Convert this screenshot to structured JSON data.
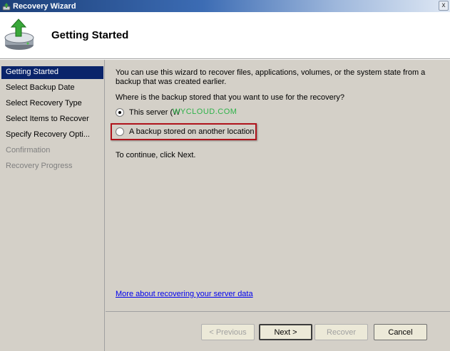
{
  "window": {
    "title": "Recovery Wizard",
    "close_glyph": "x"
  },
  "header": {
    "title": "Getting Started"
  },
  "nav": {
    "items": [
      {
        "label": "Getting Started",
        "state": "active"
      },
      {
        "label": "Select Backup Date",
        "state": "enabled"
      },
      {
        "label": "Select Recovery Type",
        "state": "enabled"
      },
      {
        "label": "Select Items to Recover",
        "state": "enabled"
      },
      {
        "label": "Specify Recovery Opti...",
        "state": "enabled"
      },
      {
        "label": "Confirmation",
        "state": "disabled"
      },
      {
        "label": "Recovery Progress",
        "state": "disabled"
      }
    ]
  },
  "content": {
    "intro": "You can use this wizard to recover files, applications, volumes, or the system state from a backup that was created earlier.",
    "question": "Where is the backup stored that you want to use for the recovery?",
    "options": [
      {
        "label": "This server (W",
        "checked": true
      },
      {
        "label": "A backup stored on another location",
        "checked": false
      }
    ],
    "watermark": "WYCLOUD.COM",
    "continue_text": "To continue, click Next.",
    "help_link": "More about recovering your server data"
  },
  "buttons": {
    "previous": "< Previous",
    "next": "Next >",
    "recover": "Recover",
    "cancel": "Cancel"
  },
  "colors": {
    "nav_selected": "#0a246a",
    "highlight_border": "#b0141c",
    "watermark": "#2fb34a",
    "link": "#0000ee"
  }
}
